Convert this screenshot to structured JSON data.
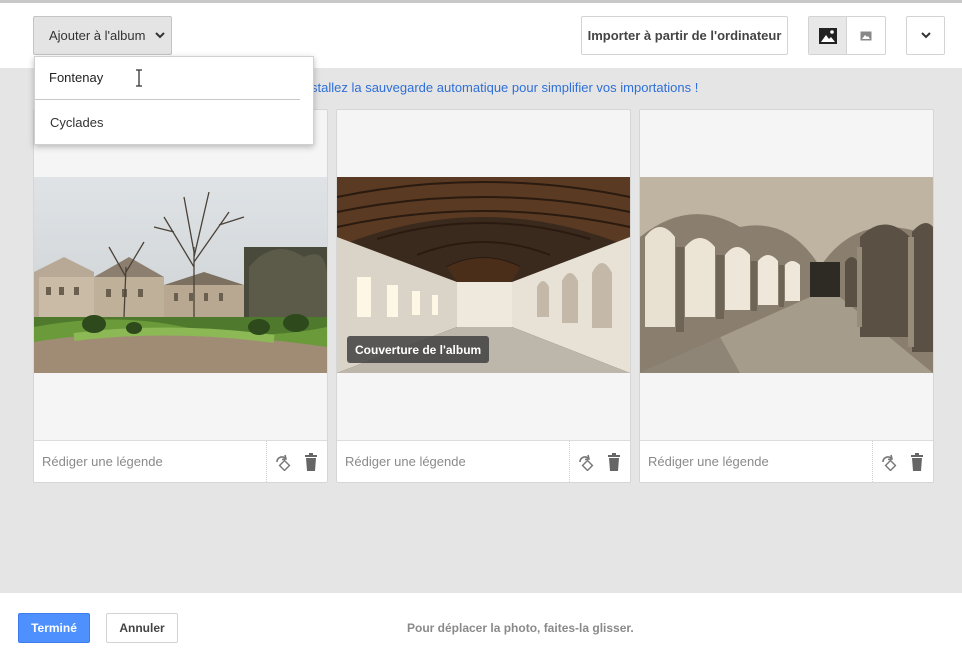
{
  "toolbar": {
    "album_button_label": "Ajouter à l'album",
    "import_button_label": "Importer à partir de l'ordinateur",
    "view_toggle": [
      "large-photo-icon",
      "small-photo-icon"
    ],
    "more_icon": "chevron-down-icon"
  },
  "album_menu": {
    "new_album_value": "Fontenay",
    "options": [
      "Cyclades"
    ]
  },
  "banner_text": "stallez la sauvegarde automatique pour simplifier vos importations !",
  "photos": [
    {
      "caption_placeholder": "Rédiger une légende",
      "cover": false,
      "scene": "abbey-garden"
    },
    {
      "caption_placeholder": "Rédiger une légende",
      "cover": true,
      "cover_label": "Couverture de l'album",
      "scene": "vaulted-hall"
    },
    {
      "caption_placeholder": "Rédiger une légende",
      "cover": false,
      "scene": "cloister"
    }
  ],
  "footer": {
    "done_label": "Terminé",
    "cancel_label": "Annuler",
    "hint": "Pour déplacer la photo, faites-la glisser."
  },
  "colors": {
    "accent": "#4d90fe",
    "link": "#2f6fd8",
    "workspace_bg": "#e5e5e5"
  }
}
